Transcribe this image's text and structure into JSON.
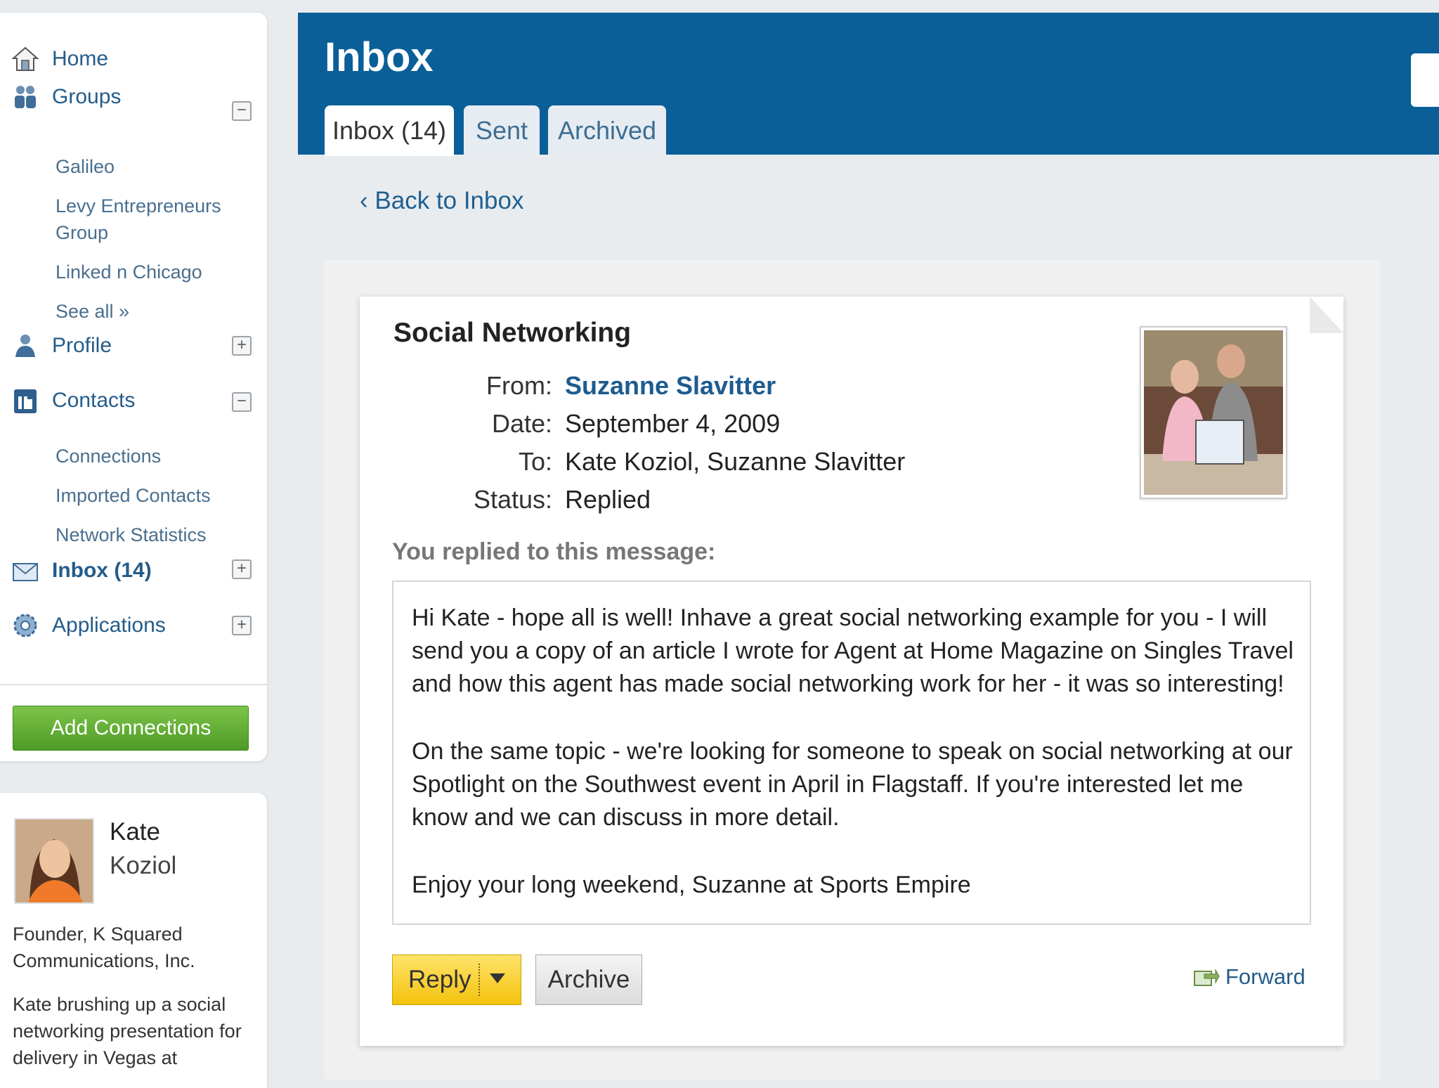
{
  "sidebar": {
    "items": [
      {
        "label": "Home"
      },
      {
        "label": "Groups"
      },
      {
        "label": "Profile"
      },
      {
        "label": "Contacts"
      },
      {
        "label": "Inbox (14)"
      },
      {
        "label": "Applications"
      }
    ],
    "groups_sub": [
      "Galileo",
      "Levy Entrepreneurs Group",
      "Linked n Chicago",
      "See all »"
    ],
    "contacts_sub": [
      "Connections",
      "Imported Contacts",
      "Network Statistics"
    ],
    "add_connections_label": "Add Connections",
    "toggles": {
      "groups": "−",
      "profile": "+",
      "contacts": "−",
      "inbox": "+",
      "applications": "+"
    }
  },
  "profile": {
    "first_name": "Kate",
    "last_name": "Koziol",
    "headline": "Founder, K Squared Communications, Inc.",
    "status": "Kate brushing up a social networking presentation for delivery in Vegas at"
  },
  "header": {
    "title": "Inbox",
    "tabs": [
      {
        "label": "Inbox (14)",
        "active": true
      },
      {
        "label": "Sent",
        "active": false
      },
      {
        "label": "Archived",
        "active": false
      }
    ]
  },
  "back_link": "‹ Back to Inbox",
  "message": {
    "subject": "Social Networking",
    "from_label": "From:",
    "from": "Suzanne Slavitter",
    "date_label": "Date:",
    "date": "September 4, 2009",
    "to_label": "To:",
    "to": "Kate Koziol, Suzanne Slavitter",
    "status_label": "Status:",
    "status": "Replied",
    "replied_heading": "You replied to this message:",
    "body": [
      "Hi Kate - hope all is well! Inhave a great social networking example for you - I will send you a copy of an article I wrote for Agent at Home Magazine on Singles Travel and how this agent has made social networking work for her - it was so interesting!",
      "On the same topic - we're looking for someone to speak on social networking at our Spotlight on the Southwest event in April in Flagstaff. If you're interested let me know and we can discuss in more detail.",
      "Enjoy your long weekend, Suzanne at Sports Empire"
    ]
  },
  "actions": {
    "reply_label": "Reply",
    "archive_label": "Archive",
    "forward_label": "Forward"
  },
  "colors": {
    "header_blue": "#0a5f98",
    "link_blue": "#245c8a",
    "reply_yellow": "#f4c20d",
    "add_green": "#5aa830"
  }
}
